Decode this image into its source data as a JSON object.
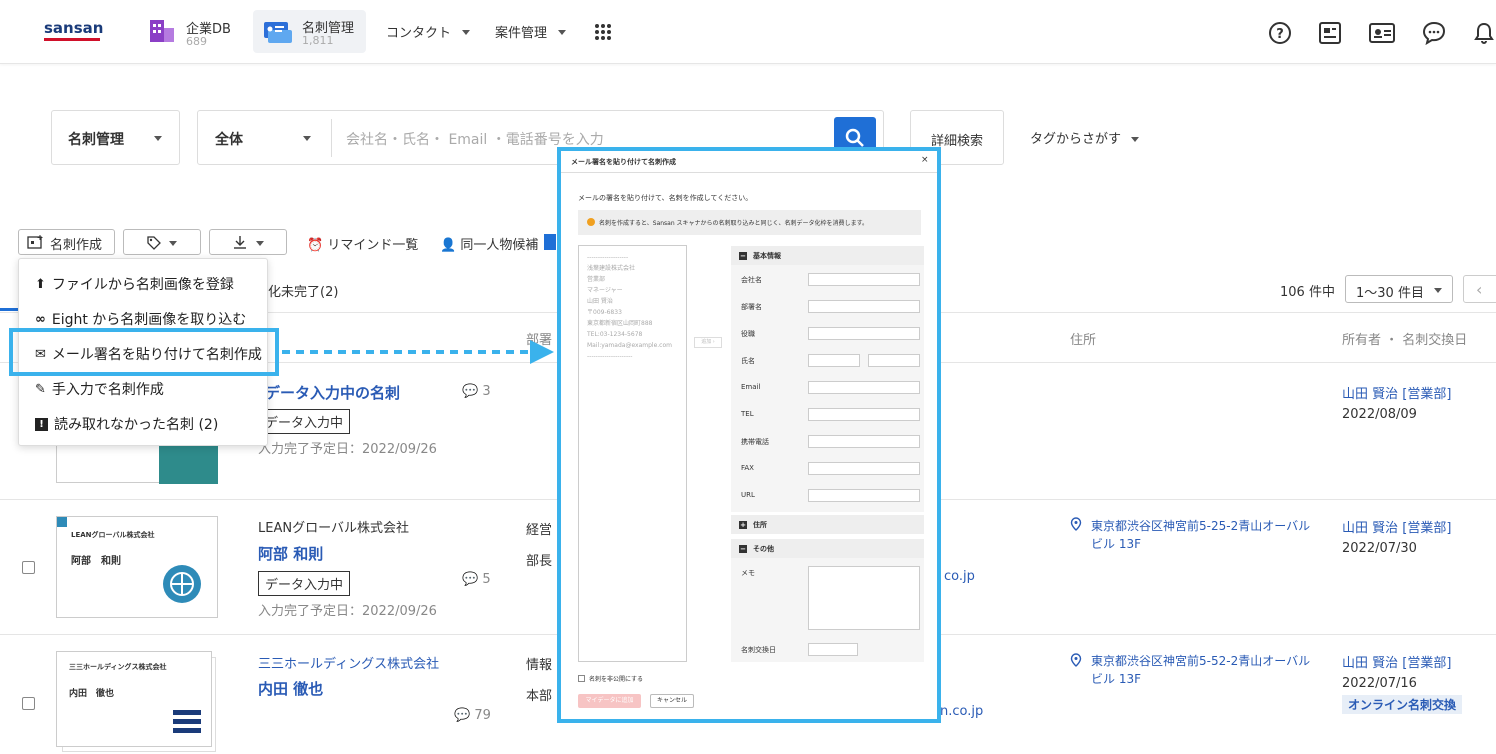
{
  "header": {
    "logo": "sansan",
    "nav": [
      {
        "label": "企業DB",
        "count": "689"
      },
      {
        "label": "名刺管理",
        "count": "1,811"
      },
      {
        "label": "コンタクト"
      },
      {
        "label": "案件管理"
      }
    ]
  },
  "search": {
    "scope": "名刺管理",
    "filter": "全体",
    "placeholder": "会社名・氏名・ Email ・電話番号を入力",
    "advanced": "詳細検索",
    "tags": "タグからさがす"
  },
  "toolbar": {
    "create": "名刺作成",
    "remind": "リマインド一覧",
    "duplicate": "同一人物候補"
  },
  "menu": [
    "ファイルから名刺画像を登録",
    "Eight から名刺画像を取り込む",
    "メール署名を貼り付けて名刺作成",
    "手入力で名刺作成",
    "読み取れなかった名刺 (2)"
  ],
  "tab_partial": "化未完了(2)",
  "pagination": {
    "total": "106 件中",
    "range": "1〜30 件目"
  },
  "columns": {
    "dept": "部署",
    "address": "住所",
    "owner": "所有者 ・ 名刺交換日"
  },
  "rows": [
    {
      "name": "データ入力中の名刺",
      "tag": "データ入力中",
      "eta": "入力完了予定日：2022/09/26",
      "comments": "3",
      "owner": "山田 賢治 [営業部]",
      "date": "2022/08/09"
    },
    {
      "company": "LEANグローバル株式会社",
      "name": "阿部 和則",
      "tag": "データ入力中",
      "eta": "入力完了予定日：2022/09/26",
      "comments": "5",
      "dept1": "経営",
      "dept2": "部長",
      "email_tail": "co.jp",
      "address": "東京都渋谷区神宮前5-25-2青山オーバルビル 13F",
      "owner": "山田 賢治 [営業部]",
      "date": "2022/07/30",
      "card": {
        "company": "LEANグローバル株式会社",
        "name": "阿部　和則"
      }
    },
    {
      "company": "三三ホールディングス株式会社",
      "name": "内田 徹也",
      "comments": "79",
      "dept1": "情報",
      "dept2": "本部",
      "email_tail": "n.co.jp",
      "address": "東京都渋谷区神宮前5-52-2青山オーバルビル 13F",
      "owner": "山田 賢治 [営業部]",
      "date": "2022/07/16",
      "badge": "オンライン名刺交換",
      "card": {
        "company": "三三ホールディングス株式会社",
        "name": "内田　徹也"
      }
    }
  ],
  "modal": {
    "title": "メール署名を貼り付けて名刺作成",
    "intro": "メールの署名を貼り付けて、名刺を作成してください。",
    "notice": "名刺を作成すると、Sansan スキャナからの名刺取り込みと同じく、名刺データ化枠を消費します。",
    "signature": [
      "-------------------",
      "浅葉建設株式会社",
      "営業部",
      "マネージャー",
      "山田 賢治",
      "〒009-6833",
      "東京都新宿区山岡町888",
      "TEL:03-1234-5678",
      "Mail:yamada@example.com",
      "---------------------"
    ],
    "arrow_btn": "追加 ›",
    "sections": {
      "basic": "基本情報",
      "address": "住所",
      "other": "その他"
    },
    "fields": [
      "会社名",
      "部署名",
      "役職",
      "氏名",
      "Email",
      "TEL",
      "携帯電話",
      "FAX",
      "URL"
    ],
    "memo": "メモ",
    "exchange_date": "名刺交換日",
    "private": "名刺を非公開にする",
    "submit": "マイデータに追加",
    "cancel": "キャンセル",
    "close": "×"
  },
  "colors": {
    "accent": "#3ab2ec",
    "link": "#2a5bb5",
    "primary": "#1f6fd6"
  }
}
